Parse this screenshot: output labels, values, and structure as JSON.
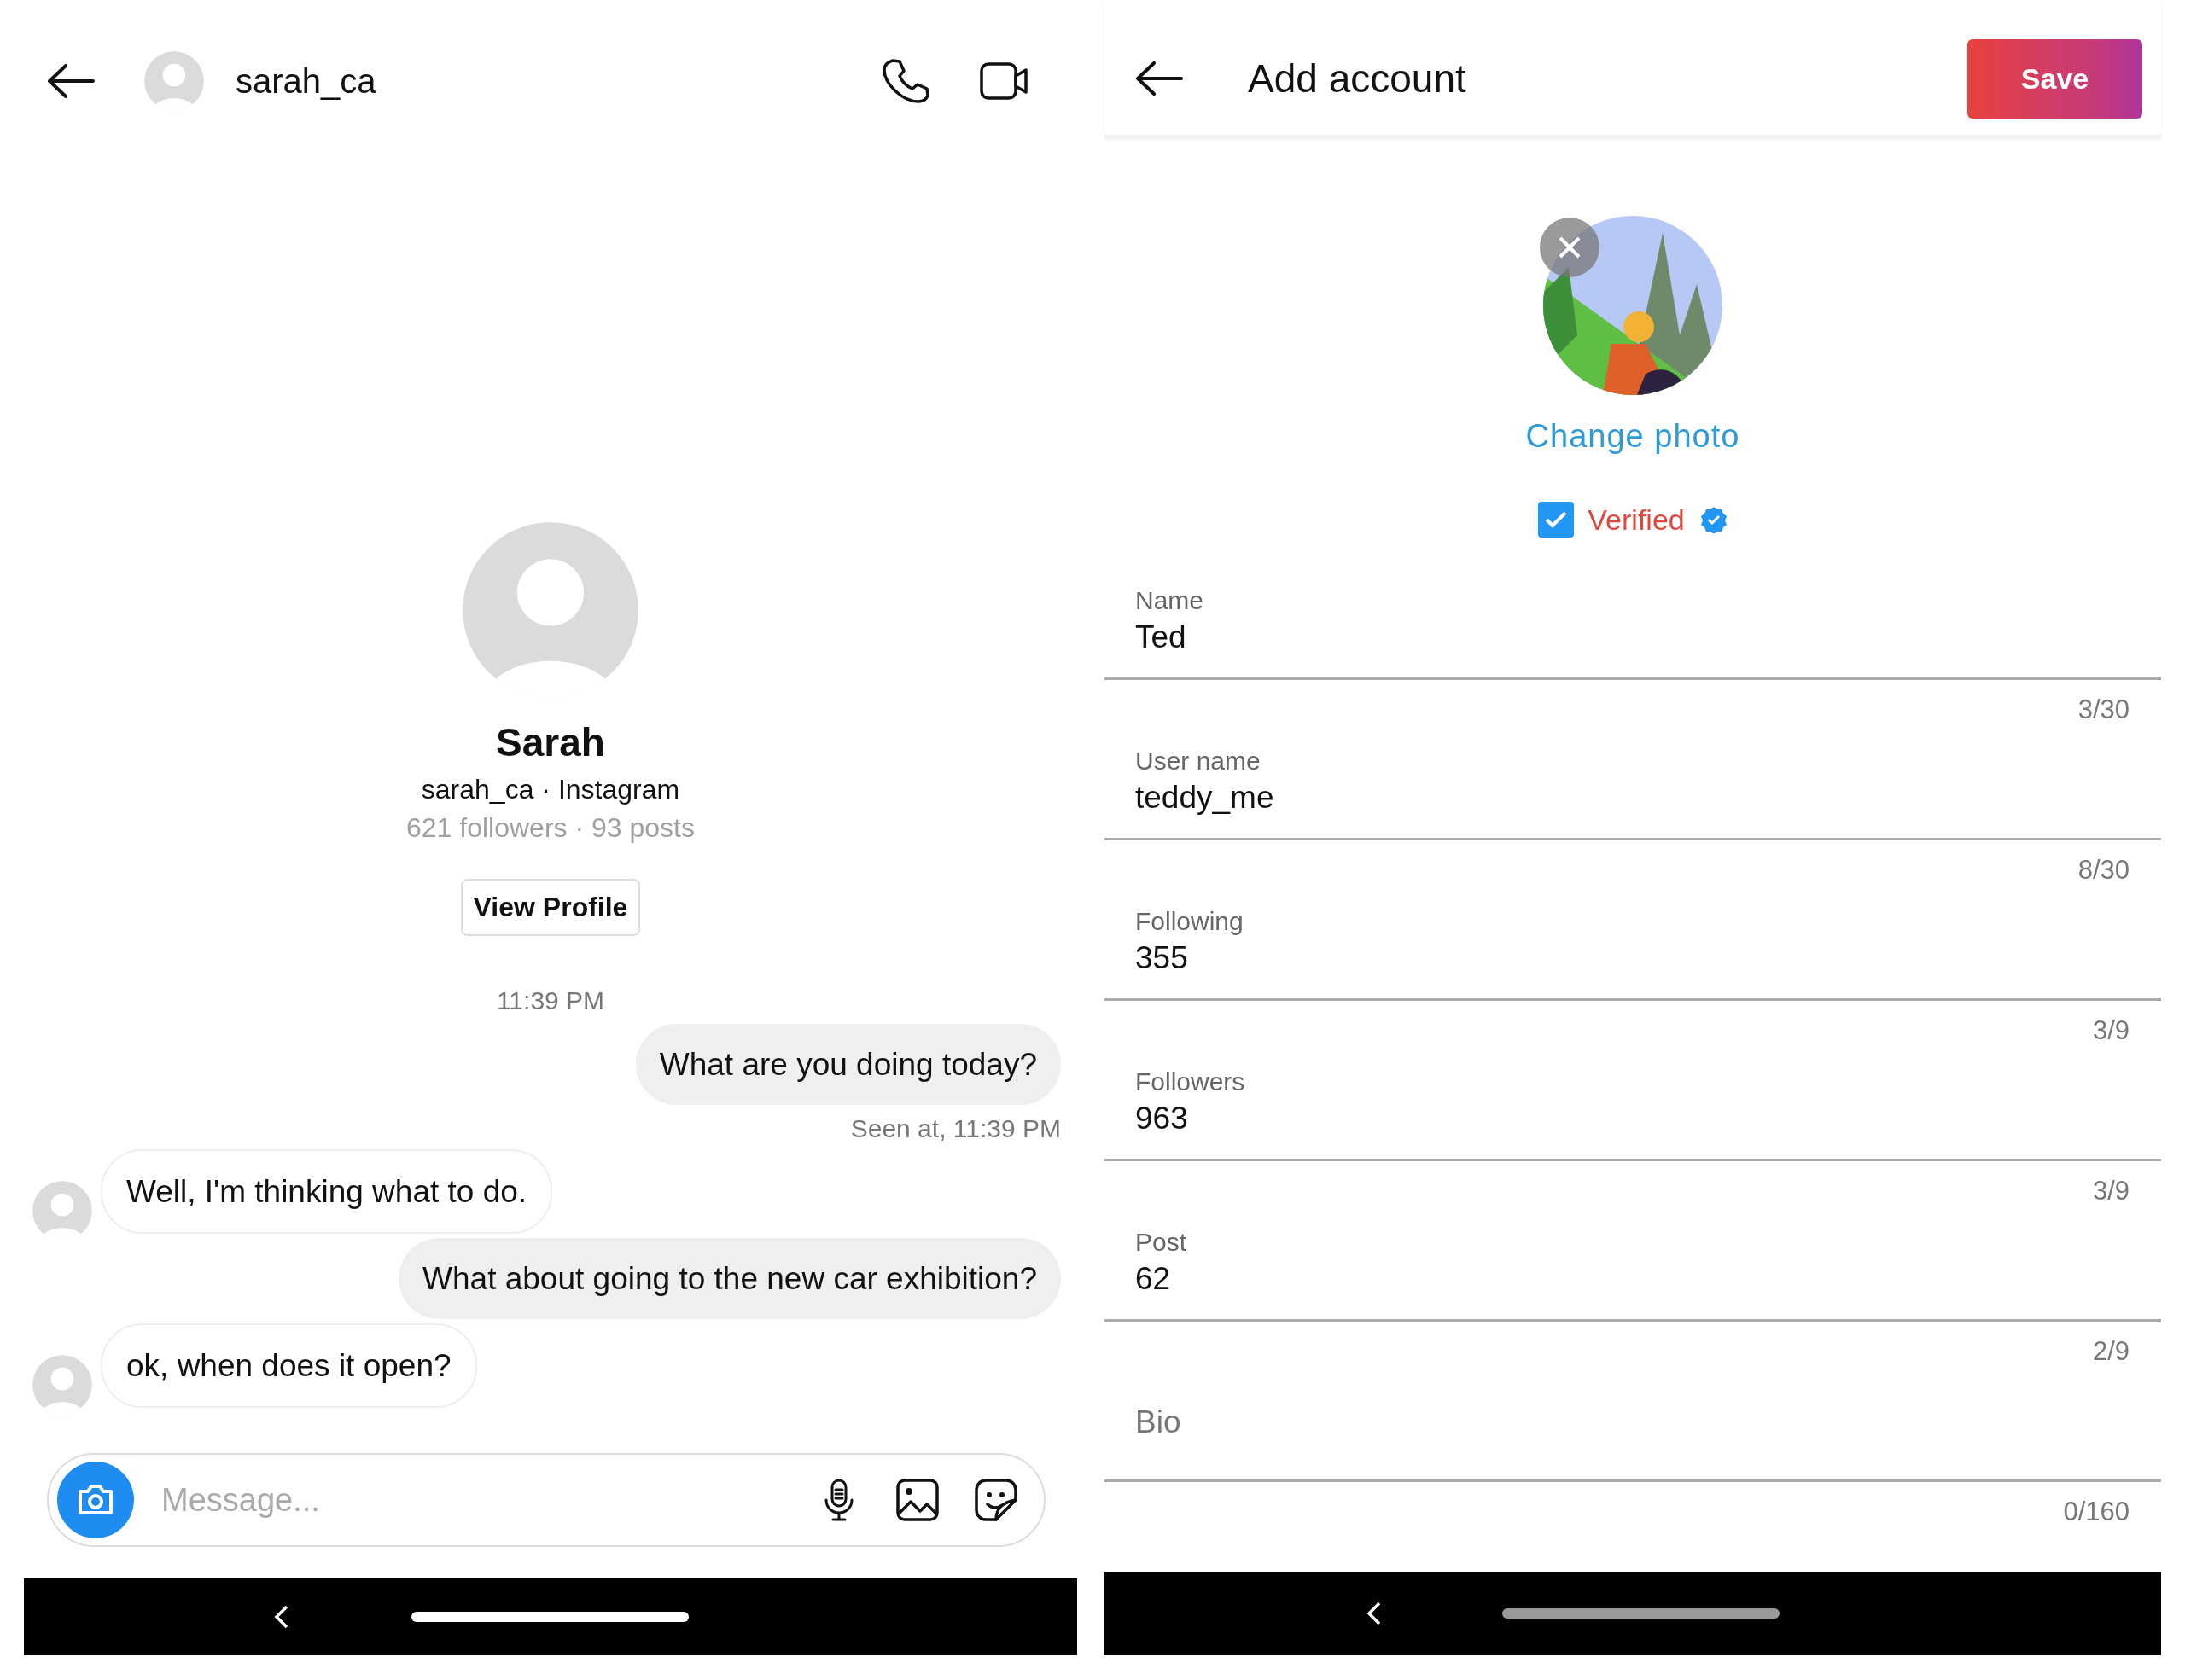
{
  "chat": {
    "header": {
      "username": "sarah_ca"
    },
    "profile": {
      "name": "Sarah",
      "subtitle": "sarah_ca · Instagram",
      "stats": "621 followers · 93 posts",
      "button": "View Profile"
    },
    "timestamp": "11:39 PM",
    "messages": [
      {
        "kind": "sent",
        "text": "What are you doing today?",
        "seen": "Seen at, 11:39 PM"
      },
      {
        "kind": "received",
        "text": "Well, I'm thinking what to do."
      },
      {
        "kind": "sent",
        "text": "What about going to the new car exhibition?"
      },
      {
        "kind": "received",
        "text": "ok, when does it open?"
      }
    ],
    "composer": {
      "placeholder": "Message..."
    }
  },
  "editor": {
    "title": "Add account",
    "save": "Save",
    "change_photo": "Change photo",
    "verified": {
      "label": "Verified",
      "checked": true
    },
    "fields": [
      {
        "label": "Name",
        "value": "Ted",
        "counter": "3/30"
      },
      {
        "label": "User name",
        "value": "teddy_me",
        "counter": "8/30"
      },
      {
        "label": "Following",
        "value": "355",
        "counter": "3/9"
      },
      {
        "label": "Followers",
        "value": "963",
        "counter": "3/9"
      },
      {
        "label": "Post",
        "value": "62",
        "counter": "2/9"
      },
      {
        "placeholder": "Bio",
        "counter": "0/160"
      }
    ]
  }
}
